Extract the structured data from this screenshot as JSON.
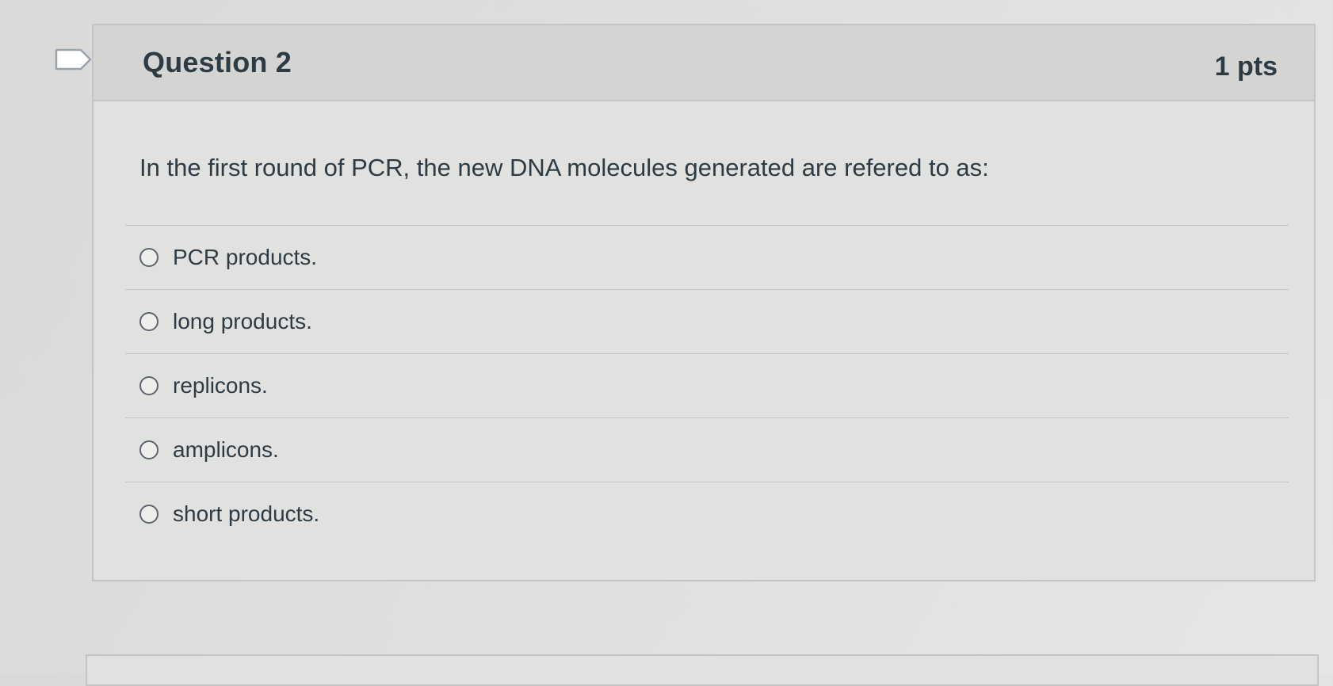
{
  "question": {
    "title": "Question 2",
    "points": "1 pts",
    "text": "In the first round of PCR, the new DNA molecules generated are refered to as:",
    "answers": [
      {
        "label": "PCR products."
      },
      {
        "label": "long products."
      },
      {
        "label": "replicons."
      },
      {
        "label": "amplicons."
      },
      {
        "label": "short products."
      }
    ]
  },
  "icons": {
    "flag": "flag-question-icon",
    "radio": "radio-unchecked-icon"
  },
  "colors": {
    "text": "#2d3b45",
    "border": "#c3c4c3",
    "header_bg": "#d4d4d2",
    "body_bg": "#e1e1df"
  }
}
